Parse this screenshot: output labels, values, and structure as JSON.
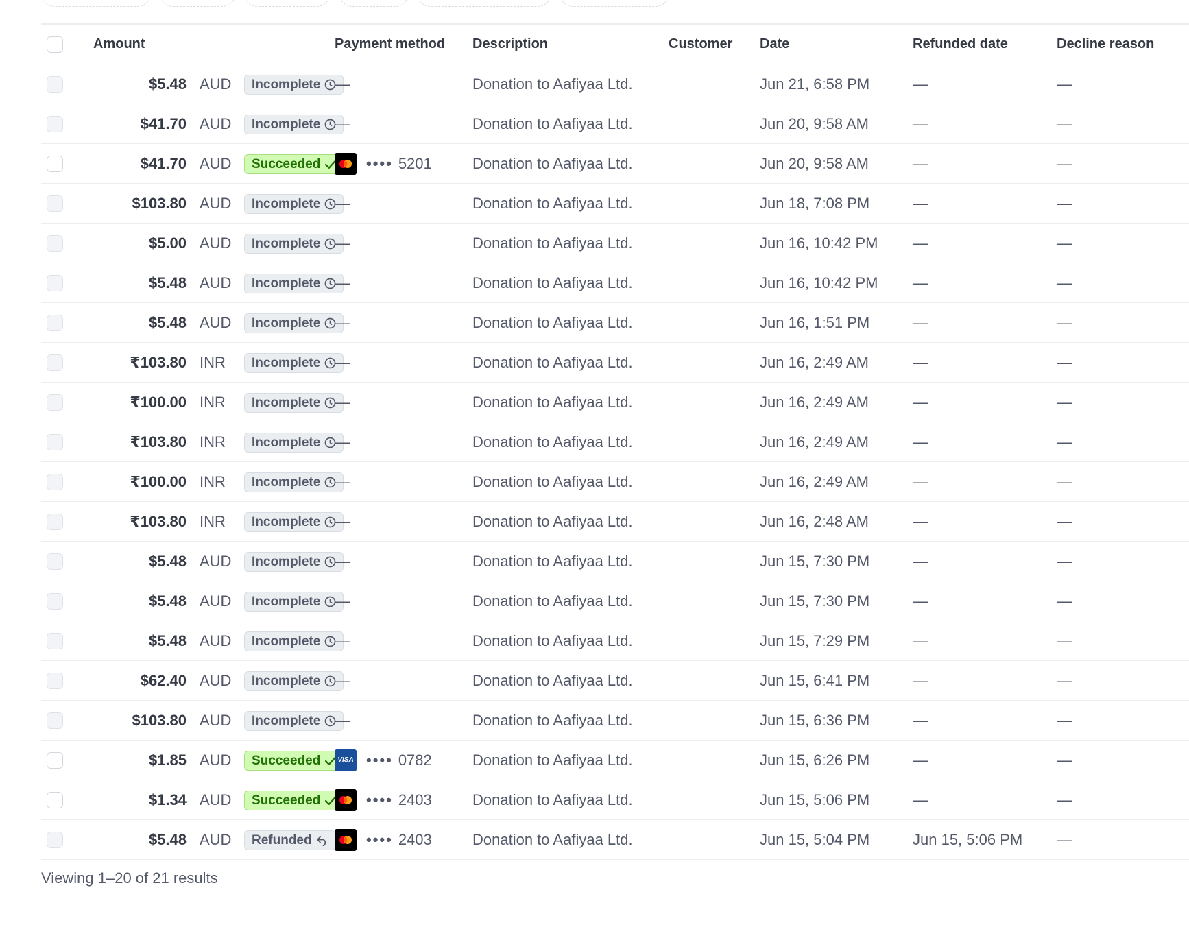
{
  "columns": {
    "amount": "Amount",
    "payment_method": "Payment method",
    "description": "Description",
    "customer": "Customer",
    "date": "Date",
    "refunded_date": "Refunded date",
    "decline_reason": "Decline reason"
  },
  "rows": [
    {
      "amount": "$5.48",
      "currency": "AUD",
      "status": "Incomplete",
      "status_kind": "incomplete",
      "card_brand": "",
      "card_last4": "—",
      "description": "Donation to Aafiyaa Ltd.",
      "date": "Jun 21, 6:58 PM",
      "refunded_date": "—",
      "decline_reason": "—"
    },
    {
      "amount": "$41.70",
      "currency": "AUD",
      "status": "Incomplete",
      "status_kind": "incomplete",
      "card_brand": "",
      "card_last4": "—",
      "description": "Donation to Aafiyaa Ltd.",
      "date": "Jun 20, 9:58 AM",
      "refunded_date": "—",
      "decline_reason": "—"
    },
    {
      "amount": "$41.70",
      "currency": "AUD",
      "status": "Succeeded",
      "status_kind": "succeeded",
      "card_brand": "mastercard-icon",
      "card_dots": "••••",
      "card_last4": "5201",
      "description": "Donation to Aafiyaa Ltd.",
      "date": "Jun 20, 9:58 AM",
      "refunded_date": "—",
      "decline_reason": "—"
    },
    {
      "amount": "$103.80",
      "currency": "AUD",
      "status": "Incomplete",
      "status_kind": "incomplete",
      "card_brand": "",
      "card_last4": "—",
      "description": "Donation to Aafiyaa Ltd.",
      "date": "Jun 18, 7:08 PM",
      "refunded_date": "—",
      "decline_reason": "—"
    },
    {
      "amount": "$5.00",
      "currency": "AUD",
      "status": "Incomplete",
      "status_kind": "incomplete",
      "card_brand": "",
      "card_last4": "—",
      "description": "Donation to Aafiyaa Ltd.",
      "date": "Jun 16, 10:42 PM",
      "refunded_date": "—",
      "decline_reason": "—"
    },
    {
      "amount": "$5.48",
      "currency": "AUD",
      "status": "Incomplete",
      "status_kind": "incomplete",
      "card_brand": "",
      "card_last4": "—",
      "description": "Donation to Aafiyaa Ltd.",
      "date": "Jun 16, 10:42 PM",
      "refunded_date": "—",
      "decline_reason": "—"
    },
    {
      "amount": "$5.48",
      "currency": "AUD",
      "status": "Incomplete",
      "status_kind": "incomplete",
      "card_brand": "",
      "card_last4": "—",
      "description": "Donation to Aafiyaa Ltd.",
      "date": "Jun 16, 1:51 PM",
      "refunded_date": "—",
      "decline_reason": "—"
    },
    {
      "amount": "₹103.80",
      "currency": "INR",
      "status": "Incomplete",
      "status_kind": "incomplete",
      "card_brand": "",
      "card_last4": "—",
      "description": "Donation to Aafiyaa Ltd.",
      "date": "Jun 16, 2:49 AM",
      "refunded_date": "—",
      "decline_reason": "—"
    },
    {
      "amount": "₹100.00",
      "currency": "INR",
      "status": "Incomplete",
      "status_kind": "incomplete",
      "card_brand": "",
      "card_last4": "—",
      "description": "Donation to Aafiyaa Ltd.",
      "date": "Jun 16, 2:49 AM",
      "refunded_date": "—",
      "decline_reason": "—"
    },
    {
      "amount": "₹103.80",
      "currency": "INR",
      "status": "Incomplete",
      "status_kind": "incomplete",
      "card_brand": "",
      "card_last4": "—",
      "description": "Donation to Aafiyaa Ltd.",
      "date": "Jun 16, 2:49 AM",
      "refunded_date": "—",
      "decline_reason": "—"
    },
    {
      "amount": "₹100.00",
      "currency": "INR",
      "status": "Incomplete",
      "status_kind": "incomplete",
      "card_brand": "",
      "card_last4": "—",
      "description": "Donation to Aafiyaa Ltd.",
      "date": "Jun 16, 2:49 AM",
      "refunded_date": "—",
      "decline_reason": "—"
    },
    {
      "amount": "₹103.80",
      "currency": "INR",
      "status": "Incomplete",
      "status_kind": "incomplete",
      "card_brand": "",
      "card_last4": "—",
      "description": "Donation to Aafiyaa Ltd.",
      "date": "Jun 16, 2:48 AM",
      "refunded_date": "—",
      "decline_reason": "—"
    },
    {
      "amount": "$5.48",
      "currency": "AUD",
      "status": "Incomplete",
      "status_kind": "incomplete",
      "card_brand": "",
      "card_last4": "—",
      "description": "Donation to Aafiyaa Ltd.",
      "date": "Jun 15, 7:30 PM",
      "refunded_date": "—",
      "decline_reason": "—"
    },
    {
      "amount": "$5.48",
      "currency": "AUD",
      "status": "Incomplete",
      "status_kind": "incomplete",
      "card_brand": "",
      "card_last4": "—",
      "description": "Donation to Aafiyaa Ltd.",
      "date": "Jun 15, 7:30 PM",
      "refunded_date": "—",
      "decline_reason": "—"
    },
    {
      "amount": "$5.48",
      "currency": "AUD",
      "status": "Incomplete",
      "status_kind": "incomplete",
      "card_brand": "",
      "card_last4": "—",
      "description": "Donation to Aafiyaa Ltd.",
      "date": "Jun 15, 7:29 PM",
      "refunded_date": "—",
      "decline_reason": "—"
    },
    {
      "amount": "$62.40",
      "currency": "AUD",
      "status": "Incomplete",
      "status_kind": "incomplete",
      "card_brand": "",
      "card_last4": "—",
      "description": "Donation to Aafiyaa Ltd.",
      "date": "Jun 15, 6:41 PM",
      "refunded_date": "—",
      "decline_reason": "—"
    },
    {
      "amount": "$103.80",
      "currency": "AUD",
      "status": "Incomplete",
      "status_kind": "incomplete",
      "card_brand": "",
      "card_last4": "—",
      "description": "Donation to Aafiyaa Ltd.",
      "date": "Jun 15, 6:36 PM",
      "refunded_date": "—",
      "decline_reason": "—"
    },
    {
      "amount": "$1.85",
      "currency": "AUD",
      "status": "Succeeded",
      "status_kind": "succeeded",
      "card_brand": "visa-icon",
      "card_brand_text": "VISA",
      "card_dots": "••••",
      "card_last4": "0782",
      "description": "Donation to Aafiyaa Ltd.",
      "date": "Jun 15, 6:26 PM",
      "refunded_date": "—",
      "decline_reason": "—"
    },
    {
      "amount": "$1.34",
      "currency": "AUD",
      "status": "Succeeded",
      "status_kind": "succeeded",
      "card_brand": "mastercard-icon",
      "card_dots": "••••",
      "card_last4": "2403",
      "description": "Donation to Aafiyaa Ltd.",
      "date": "Jun 15, 5:06 PM",
      "refunded_date": "—",
      "decline_reason": "—"
    },
    {
      "amount": "$5.48",
      "currency": "AUD",
      "status": "Refunded",
      "status_kind": "refunded",
      "card_brand": "mastercard-icon",
      "card_dots": "••••",
      "card_last4": "2403",
      "description": "Donation to Aafiyaa Ltd.",
      "date": "Jun 15, 5:04 PM",
      "refunded_date": "Jun 15, 5:06 PM",
      "decline_reason": "—"
    }
  ],
  "footer": {
    "summary": "Viewing 1–20 of 21 results"
  },
  "colors": {
    "succeeded_bg": "#d1fab3",
    "succeeded_text": "#217005",
    "neutral_badge_bg": "#ebeef1",
    "neutral_badge_text": "#545969"
  }
}
